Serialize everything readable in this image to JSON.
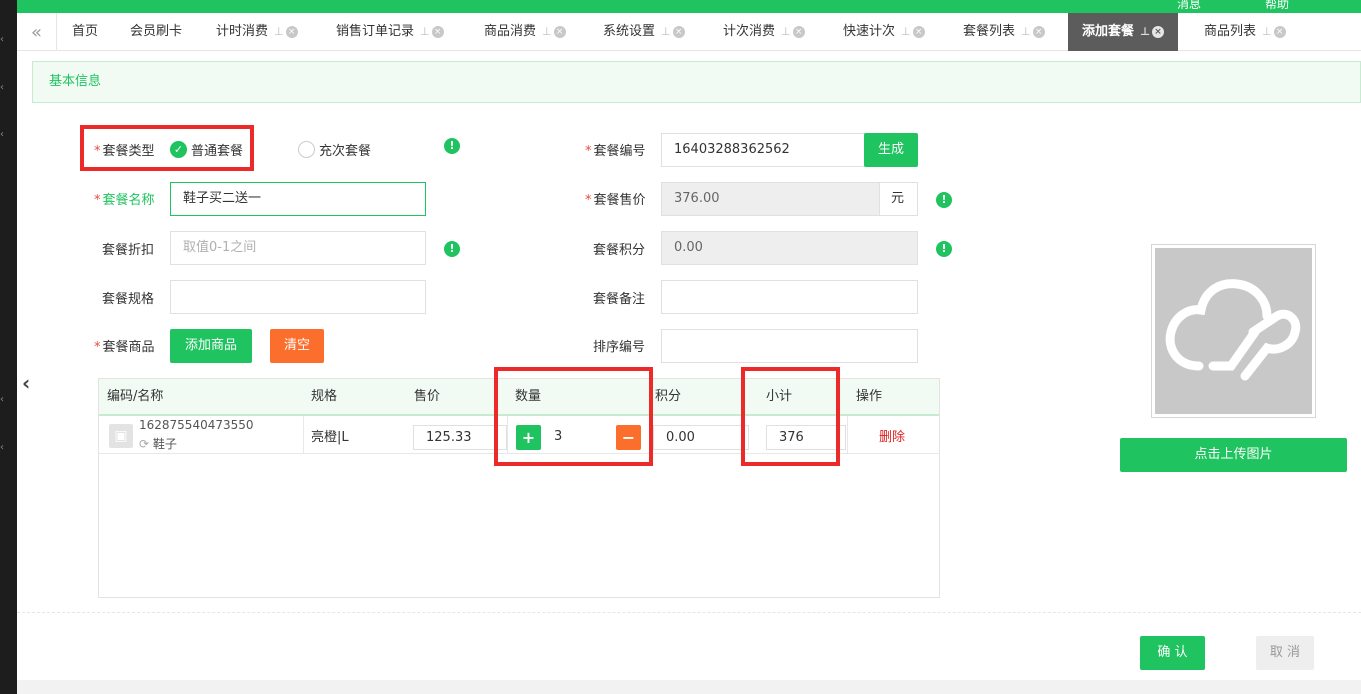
{
  "topbar": {
    "right_texts": [
      "消息",
      "帮助"
    ]
  },
  "tabs": [
    {
      "label": "首页",
      "closable": false
    },
    {
      "label": "会员刷卡",
      "closable": false
    },
    {
      "label": "计时消费",
      "closable": true
    },
    {
      "label": "销售订单记录",
      "closable": true
    },
    {
      "label": "商品消费",
      "closable": true
    },
    {
      "label": "系统设置",
      "closable": true
    },
    {
      "label": "计次消费",
      "closable": true
    },
    {
      "label": "快速计次",
      "closable": true
    },
    {
      "label": "套餐列表",
      "closable": true
    },
    {
      "label": "添加套餐",
      "closable": true,
      "active": true
    },
    {
      "label": "商品列表",
      "closable": true
    }
  ],
  "section": {
    "title": "基本信息"
  },
  "form": {
    "type_label": "套餐类型",
    "type_options": [
      "普通套餐",
      "充次套餐"
    ],
    "name_label": "套餐名称",
    "name_value": "鞋子买二送一",
    "discount_label": "套餐折扣",
    "discount_placeholder": "取值0-1之间",
    "spec_label": "套餐规格",
    "products_label": "套餐商品",
    "add_product_button": "添加商品",
    "clear_button": "清空",
    "code_label": "套餐编号",
    "code_value": "16403288362562",
    "generate_button": "生成",
    "price_label": "套餐售价",
    "price_value": "376.00",
    "price_unit": "元",
    "points_label": "套餐积分",
    "points_value": "0.00",
    "remark_label": "套餐备注",
    "sort_label": "排序编号"
  },
  "table": {
    "headers": [
      "编码/名称",
      "规格",
      "售价",
      "数量",
      "积分",
      "小计",
      "操作"
    ],
    "rows": [
      {
        "code": "162875540473550",
        "name": "鞋子",
        "spec": "亮橙|L",
        "price": "125.33",
        "qty": "3",
        "points": "0.00",
        "subtotal": "376",
        "action": "删除"
      }
    ]
  },
  "upload": {
    "button": "点击上传图片"
  },
  "footer": {
    "confirm": "确 认",
    "cancel": "取 消"
  },
  "colors": {
    "primary": "#1fc35f",
    "orange": "#fb6e2c",
    "highlight": "#ec2a2a",
    "danger": "#e02020"
  }
}
